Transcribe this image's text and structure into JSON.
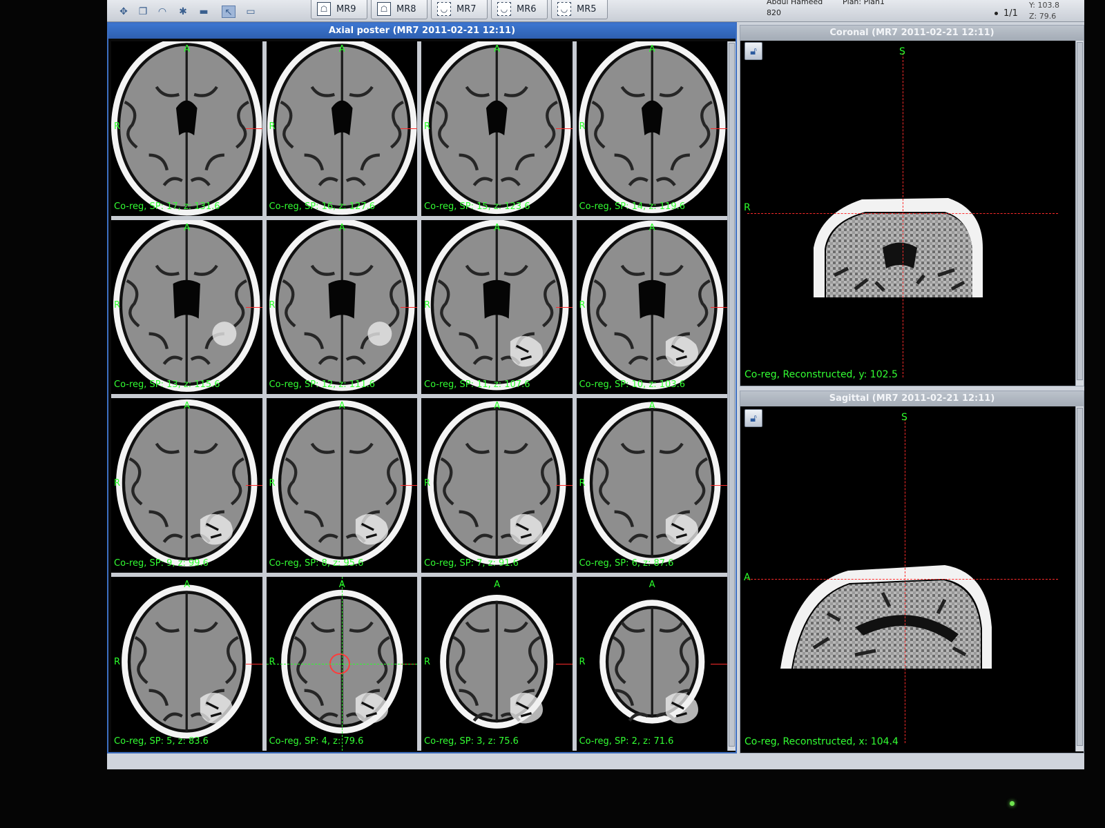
{
  "toolbar": {
    "tools": [
      "move-icon",
      "copy-icon",
      "wifi-icon",
      "asterisk-icon",
      "rectangle-icon",
      "pan-icon",
      "window-icon"
    ],
    "series_tabs": [
      {
        "label": "MR9",
        "glyph": "☖"
      },
      {
        "label": "MR8",
        "glyph": "☖"
      },
      {
        "label": "MR7",
        "glyph": "◡"
      },
      {
        "label": "MR6",
        "glyph": "◡"
      },
      {
        "label": "MR5",
        "glyph": "◡"
      }
    ],
    "patient_name": "Abdul Hameed",
    "plan": "Plan: Plan1",
    "patient_id": "820",
    "page": "1/1",
    "coord_y": "Y: 103.8",
    "coord_z": "Z: 79.6"
  },
  "axial": {
    "title": "Axial poster (MR7 2011-02-21 12:11)",
    "orient_a": "A",
    "orient_r": "R",
    "cells": [
      {
        "label": "Co-reg, SP: 17, z: 131.6",
        "lesion": 0
      },
      {
        "label": "Co-reg, SP: 16, z: 127.6",
        "lesion": 0
      },
      {
        "label": "Co-reg, SP: 15, z: 123.6",
        "lesion": 0
      },
      {
        "label": "Co-reg, SP: 14, z: 119.6",
        "lesion": 0
      },
      {
        "label": "Co-reg, SP: 13, z: 115.6",
        "lesion": 1
      },
      {
        "label": "Co-reg, SP: 12, z: 111.6",
        "lesion": 1
      },
      {
        "label": "Co-reg, SP: 11, z: 107.6",
        "lesion": 2
      },
      {
        "label": "Co-reg, SP: 10, z: 103.6",
        "lesion": 2
      },
      {
        "label": "Co-reg, SP: 9, z: 99.6",
        "lesion": 2
      },
      {
        "label": "Co-reg, SP: 8, z: 95.6",
        "lesion": 2
      },
      {
        "label": "Co-reg, SP: 7, z: 91.6",
        "lesion": 2
      },
      {
        "label": "Co-reg, SP: 6, z: 87.6",
        "lesion": 2
      },
      {
        "label": "Co-reg, SP: 5, z: 83.6",
        "lesion": 2
      },
      {
        "label": "Co-reg, SP: 4, z: 79.6",
        "lesion": 2
      },
      {
        "label": "Co-reg, SP: 3, z: 75.6",
        "lesion": 2
      },
      {
        "label": "Co-reg, SP: 2, z: 71.6",
        "lesion": 2
      }
    ]
  },
  "coronal": {
    "title": "Coronal (MR7 2011-02-21 12:11)",
    "top_letter": "S",
    "side_letter": "R",
    "label": "Co-reg, Reconstructed, y: 102.5"
  },
  "sagittal": {
    "title": "Sagittal (MR7 2011-02-21 12:11)",
    "top_letter": "S",
    "side_letter": "A",
    "label": "Co-reg, Reconstructed, x: 104.4"
  },
  "colors": {
    "overlay_text": "#33ff33",
    "crosshair": "#ff2b2b",
    "active_title": "#3c76d0"
  }
}
